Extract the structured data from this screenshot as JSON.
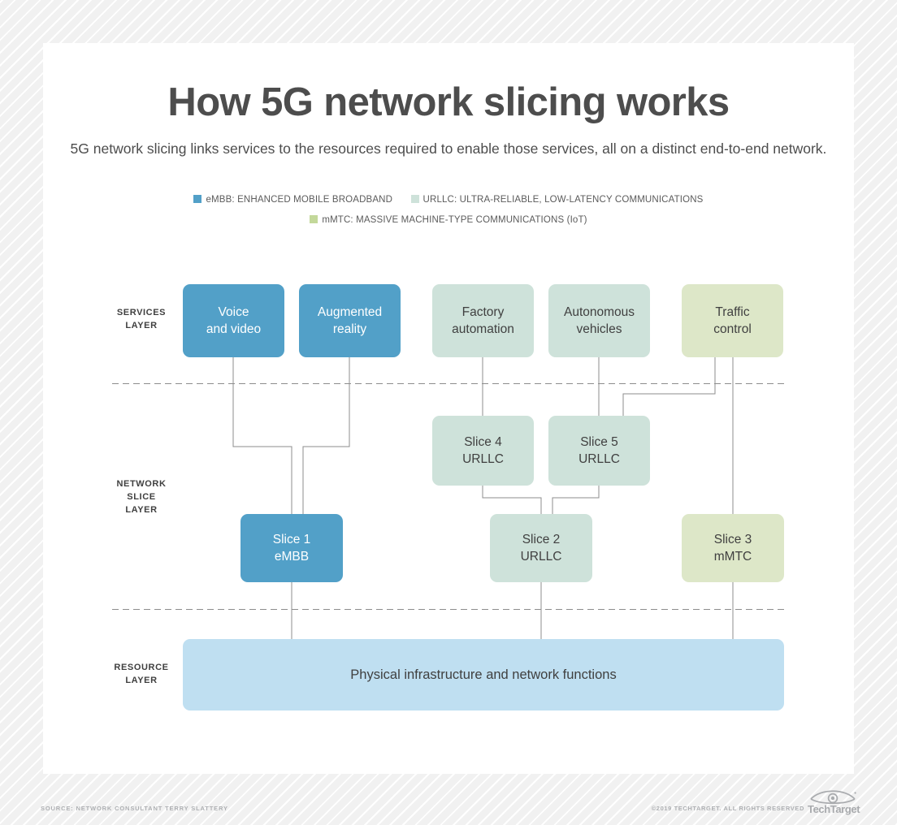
{
  "header": {
    "title": "How 5G network slicing works",
    "subtitle": "5G network slicing links services to the resources required to enable those services, all on a distinct end-to-end network."
  },
  "legend": {
    "items": [
      {
        "label": "eMBB: ENHANCED MOBILE BROADBAND",
        "color": "#52a0c8"
      },
      {
        "label": "URLLC: ULTRA-RELIABLE, LOW-LATENCY COMMUNICATIONS",
        "color": "#cee2da"
      },
      {
        "label": "mMTC: MASSIVE MACHINE-TYPE COMMUNICATIONS (IoT)",
        "color": "#c3d89a"
      }
    ]
  },
  "layers": {
    "services": "SERVICES\nLAYER",
    "services_line1": "SERVICES",
    "services_line2": "LAYER",
    "slice_line1": "NETWORK",
    "slice_line2": "SLICE",
    "slice_line3": "LAYER",
    "resource_line1": "RESOURCE",
    "resource_line2": "LAYER"
  },
  "services": [
    {
      "line1": "Voice",
      "line2": "and video",
      "color": "blue"
    },
    {
      "line1": "Augmented",
      "line2": "reality",
      "color": "blue"
    },
    {
      "line1": "Factory",
      "line2": "automation",
      "color": "teal"
    },
    {
      "line1": "Autonomous",
      "line2": "vehicles",
      "color": "teal"
    },
    {
      "line1": "Traffic",
      "line2": "control",
      "color": "green"
    }
  ],
  "slices": [
    {
      "line1": "Slice 4",
      "line2": "URLLC",
      "color": "teal"
    },
    {
      "line1": "Slice 5",
      "line2": "URLLC",
      "color": "teal"
    },
    {
      "line1": "Slice 1",
      "line2": "eMBB",
      "color": "blue"
    },
    {
      "line1": "Slice 2",
      "line2": "URLLC",
      "color": "teal"
    },
    {
      "line1": "Slice 3",
      "line2": "mMTC",
      "color": "green"
    }
  ],
  "resource": {
    "label": "Physical infrastructure and network functions"
  },
  "footer": {
    "source": "SOURCE: NETWORK CONSULTANT TERRY SLATTERY",
    "copyright": "©2019 TECHTARGET. ALL RIGHTS RESERVED",
    "logo_word": "TechTarget"
  },
  "colors": {
    "blue": "#52a0c8",
    "teal": "#cee2da",
    "green": "#dde7c8",
    "resource_blue": "#bfdff1",
    "wire": "#8d8d8d",
    "divider": "#8d8d8d",
    "card": "#ffffff",
    "text_dark": "#404040"
  }
}
